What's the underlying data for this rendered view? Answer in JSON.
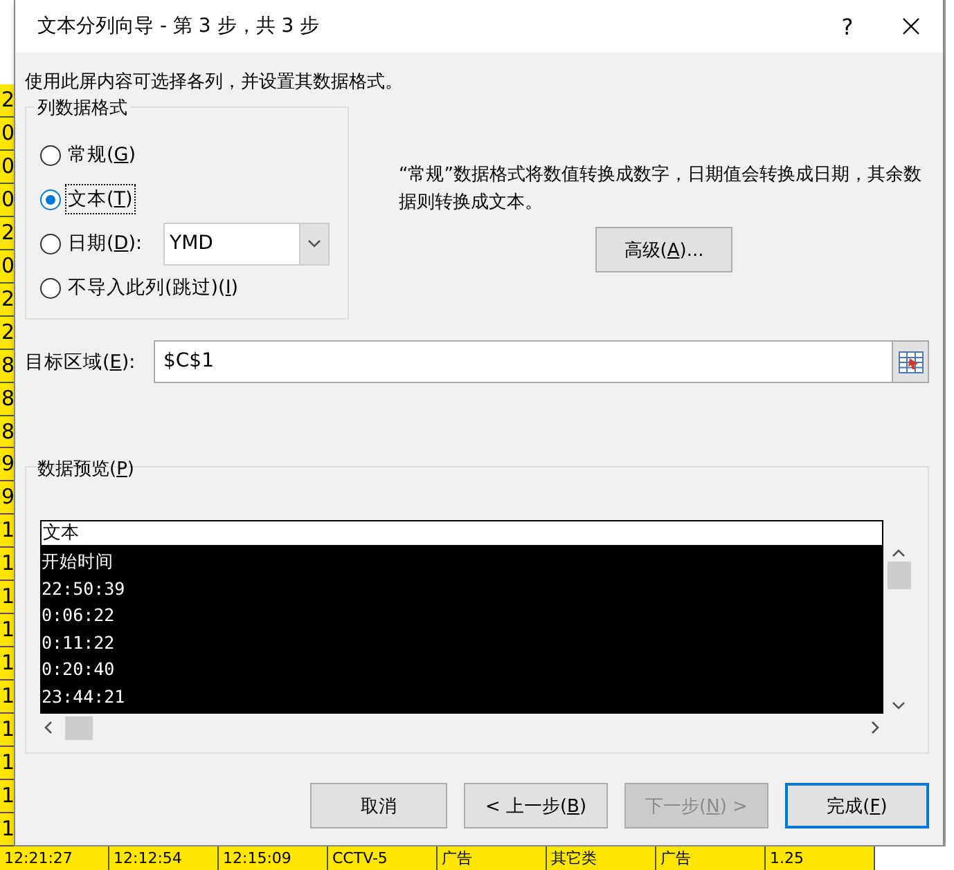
{
  "window": {
    "title": "文本分列向导 - 第 3 步，共 3 步",
    "help_button": "?"
  },
  "instruction": "使用此屏内容可选择各列，并设置其数据格式。",
  "column_format": {
    "legend": "列数据格式",
    "options": [
      {
        "before": "常规(",
        "mnemonic": "G",
        "after": ")",
        "selected": false
      },
      {
        "before": "文本(",
        "mnemonic": "T",
        "after": ")",
        "selected": true
      },
      {
        "before": "日期(",
        "mnemonic": "D",
        "after": "):",
        "selected": false,
        "kind": "date",
        "dropdown_value": "YMD"
      },
      {
        "before": "不导入此列(跳过)(",
        "mnemonic": "I",
        "after": ")",
        "selected": false
      }
    ]
  },
  "description": "“常规”数据格式将数值转换成数字，日期值会转换成日期，其余数据则转换成文本。",
  "advanced_button": {
    "before": "高级(",
    "mnemonic": "A",
    "after": ")..."
  },
  "destination": {
    "before": "目标区域(",
    "mnemonic": "E",
    "after": "):",
    "value": "$C$1"
  },
  "preview": {
    "legend_before": "数据预览(",
    "legend_mnemonic": "P",
    "legend_after": ")",
    "column_header": "文本",
    "column_selected": true,
    "rows": [
      "开始时间",
      "22:50:39",
      "0:06:22",
      "0:11:22",
      "0:20:40",
      "23:44:21"
    ]
  },
  "buttons": [
    {
      "label_before": "取消",
      "disabled": false,
      "default": false
    },
    {
      "label_before": "< 上一步(",
      "mnemonic": "B",
      "label_after": ")",
      "disabled": false,
      "default": false
    },
    {
      "label_before": "下一步(",
      "mnemonic": "N",
      "label_after": ") >",
      "disabled": true,
      "default": false
    },
    {
      "label_before": "完成(",
      "mnemonic": "F",
      "label_after": ")",
      "disabled": false,
      "default": true
    }
  ],
  "sheet": {
    "left_column": [
      "2",
      "0",
      "0",
      "0",
      "2",
      "0",
      "2",
      "2",
      "8",
      "8",
      "8",
      "9",
      "9",
      "1",
      "1",
      "1",
      "1",
      "1",
      "1",
      "1",
      "1",
      "1",
      "1"
    ],
    "bottom_row": [
      "12:21:27",
      "12:12:54",
      "12:15:09",
      "CCTV-5",
      "广告",
      "其它类",
      "广告",
      "1.25"
    ]
  }
}
